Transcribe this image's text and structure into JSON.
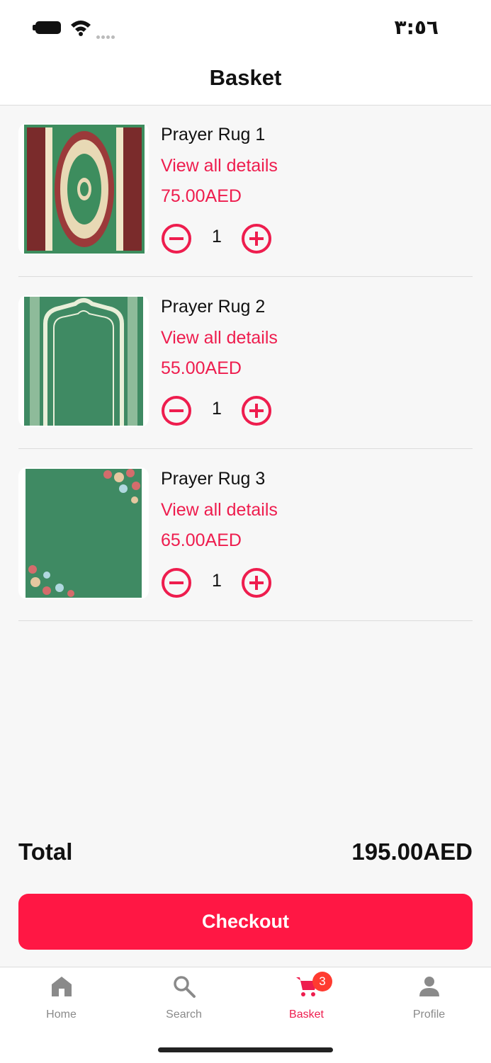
{
  "status_bar": {
    "time": "٣:٥٦"
  },
  "header": {
    "title": "Basket"
  },
  "items": [
    {
      "name": "Prayer Rug 1",
      "details_link": "View all details",
      "price": "75.00AED",
      "quantity": "1"
    },
    {
      "name": "Prayer Rug 2",
      "details_link": "View all details",
      "price": "55.00AED",
      "quantity": "1"
    },
    {
      "name": "Prayer Rug 3",
      "details_link": "View all details",
      "price": "65.00AED",
      "quantity": "1"
    }
  ],
  "summary": {
    "total_label": "Total",
    "total_value": "195.00AED"
  },
  "checkout_label": "Checkout",
  "tabs": [
    {
      "label": "Home",
      "icon": "home-icon"
    },
    {
      "label": "Search",
      "icon": "search-icon"
    },
    {
      "label": "Basket",
      "icon": "cart-icon",
      "badge": "3"
    },
    {
      "label": "Profile",
      "icon": "profile-icon"
    }
  ],
  "colors": {
    "accent": "#ee1d4e",
    "checkout": "#ff1744",
    "badge": "#ff3b30",
    "rug_green": "#3f8a63"
  }
}
